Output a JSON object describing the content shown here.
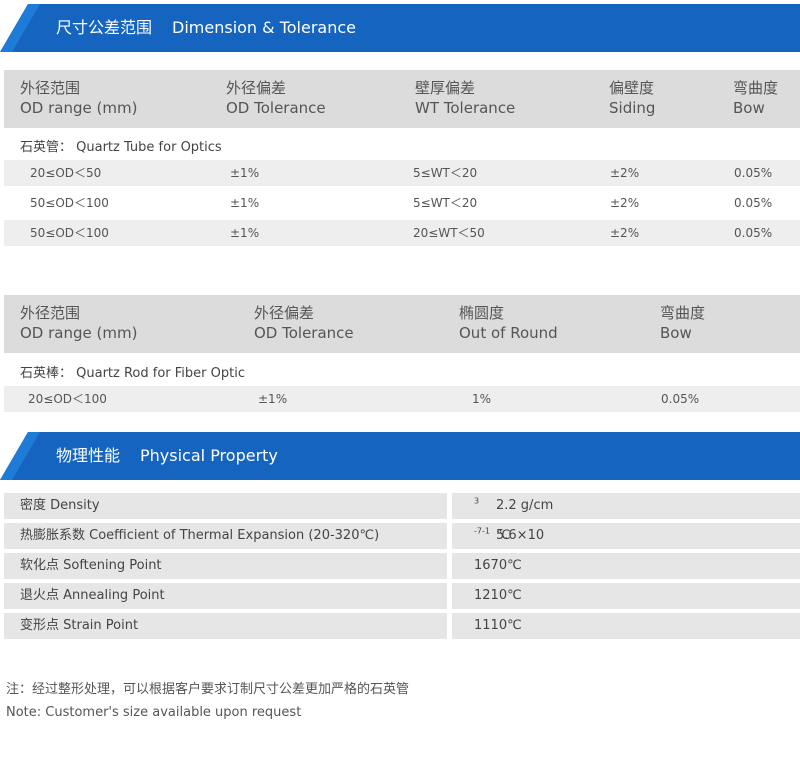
{
  "colors": {
    "banner": "#1565c0",
    "banner_edge": "#1e7bd8",
    "header_bg": "#dcdcdc",
    "row_shade": "#eeeeee"
  },
  "dimension_section": {
    "title_cn": "尺寸公差范围",
    "title_en": "Dimension & Tolerance"
  },
  "tube_table": {
    "headers": [
      {
        "cn": "外径范围",
        "en": "OD range (mm)"
      },
      {
        "cn": "外径偏差",
        "en": "OD Tolerance"
      },
      {
        "cn": "壁厚偏差",
        "en": "WT Tolerance"
      },
      {
        "cn": "偏壁度",
        "en": "Siding"
      },
      {
        "cn": "弯曲度",
        "en": "Bow"
      }
    ],
    "subheader": "石英管： Quartz Tube for Optics",
    "rows": [
      [
        "20≤OD＜50",
        "±1%",
        "5≤WT＜20",
        "±2%",
        "0.05%"
      ],
      [
        "50≤OD＜100",
        "±1%",
        "5≤WT＜20",
        "±2%",
        "0.05%"
      ],
      [
        "50≤OD＜100",
        "±1%",
        "20≤WT＜50",
        "±2%",
        "0.05%"
      ]
    ]
  },
  "rod_table": {
    "headers": [
      {
        "cn": "外径范围",
        "en": "OD range (mm)"
      },
      {
        "cn": "外径偏差",
        "en": "OD Tolerance"
      },
      {
        "cn": "椭圆度",
        "en": "Out of Round"
      },
      {
        "cn": "弯曲度",
        "en": "Bow"
      }
    ],
    "subheader": "石英棒： Quartz Rod for Fiber Optic",
    "rows": [
      [
        "20≤OD＜100",
        "±1%",
        "1%",
        "0.05%"
      ]
    ]
  },
  "physical_section": {
    "title_cn": "物理性能",
    "title_en": "Physical Property"
  },
  "properties": [
    {
      "label": "密度  Density",
      "value": "2.2 g/cm",
      "sup": "3"
    },
    {
      "label": "热膨胀系数  Coefficient of Thermal Expansion (20-320℃)",
      "value": "5.6×10",
      "sup": "-7",
      "value_tail": " ℃",
      "sup2": "-1"
    },
    {
      "label": "软化点  Softening Point",
      "value": "1670℃"
    },
    {
      "label": "退火点  Annealing Point",
      "value": "1210℃"
    },
    {
      "label": "变形点  Strain Point",
      "value": "1110℃"
    }
  ],
  "notes": {
    "cn": "注：经过整形处理，可以根据客户要求订制尺寸公差更加严格的石英管",
    "en": "Note: Customer's size available upon request"
  }
}
